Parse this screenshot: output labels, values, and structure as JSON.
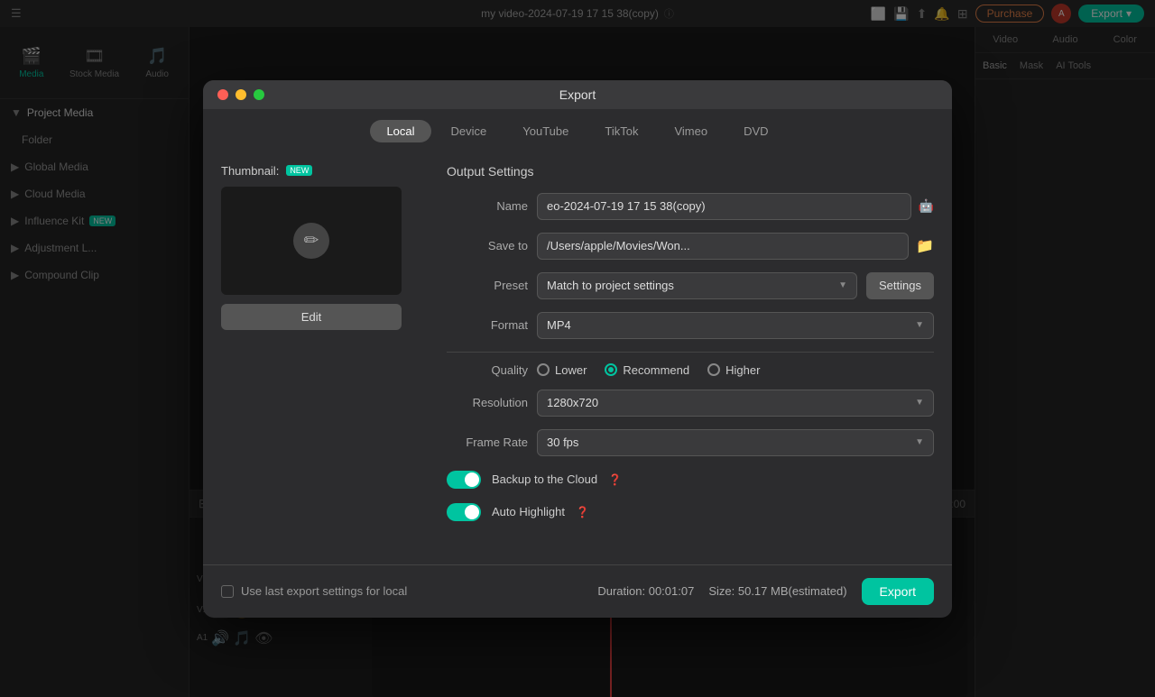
{
  "app": {
    "title": "my video-2024-07-19 17 15 38(copy)",
    "purchase_label": "Purchase",
    "export_label": "Export"
  },
  "top_nav": {
    "video_tab": "Video",
    "audio_tab": "Audio",
    "color_tab": "Color"
  },
  "right_panel": {
    "tabs": [
      "Basic",
      "Mask",
      "AI Tools"
    ]
  },
  "sidebar": {
    "tabs": [
      "Media",
      "Stock Media",
      "Audio"
    ],
    "sections": [
      {
        "label": "Project Media",
        "new": false
      },
      {
        "label": "Folder",
        "new": false
      },
      {
        "label": "Global Media",
        "new": false
      },
      {
        "label": "Cloud Media",
        "new": false
      },
      {
        "label": "Influence Kit",
        "new": true
      },
      {
        "label": "Adjustment L...",
        "new": false
      },
      {
        "label": "Compound Clip",
        "new": false
      }
    ]
  },
  "modal": {
    "title": "Export",
    "tabs": [
      "Local",
      "Device",
      "YouTube",
      "TikTok",
      "Vimeo",
      "DVD"
    ],
    "active_tab": "Local",
    "thumbnail_label": "Thumbnail:",
    "thumbnail_badge": "NEW",
    "edit_button": "Edit",
    "output_settings_title": "Output Settings",
    "fields": {
      "name_label": "Name",
      "name_value": "eo-2024-07-19 17 15 38(copy)",
      "save_to_label": "Save to",
      "save_to_value": "/Users/apple/Movies/Won...",
      "preset_label": "Preset",
      "preset_value": "Match to project settings",
      "settings_button": "Settings",
      "format_label": "Format",
      "format_value": "MP4",
      "quality_label": "Quality",
      "quality_options": [
        "Lower",
        "Recommend",
        "Higher"
      ],
      "quality_selected": "Recommend",
      "resolution_label": "Resolution",
      "resolution_value": "1280x720",
      "frame_rate_label": "Frame Rate",
      "frame_rate_value": "30 fps"
    },
    "toggles": [
      {
        "label": "Backup to the Cloud",
        "enabled": true
      },
      {
        "label": "Auto Highlight",
        "enabled": true
      }
    ],
    "bottom": {
      "checkbox_label": "Use last export settings for local",
      "duration_label": "Duration:",
      "duration_value": "00:01:07",
      "size_label": "Size:",
      "size_value": "50.17 MB(estimated)",
      "export_button": "Export"
    }
  }
}
